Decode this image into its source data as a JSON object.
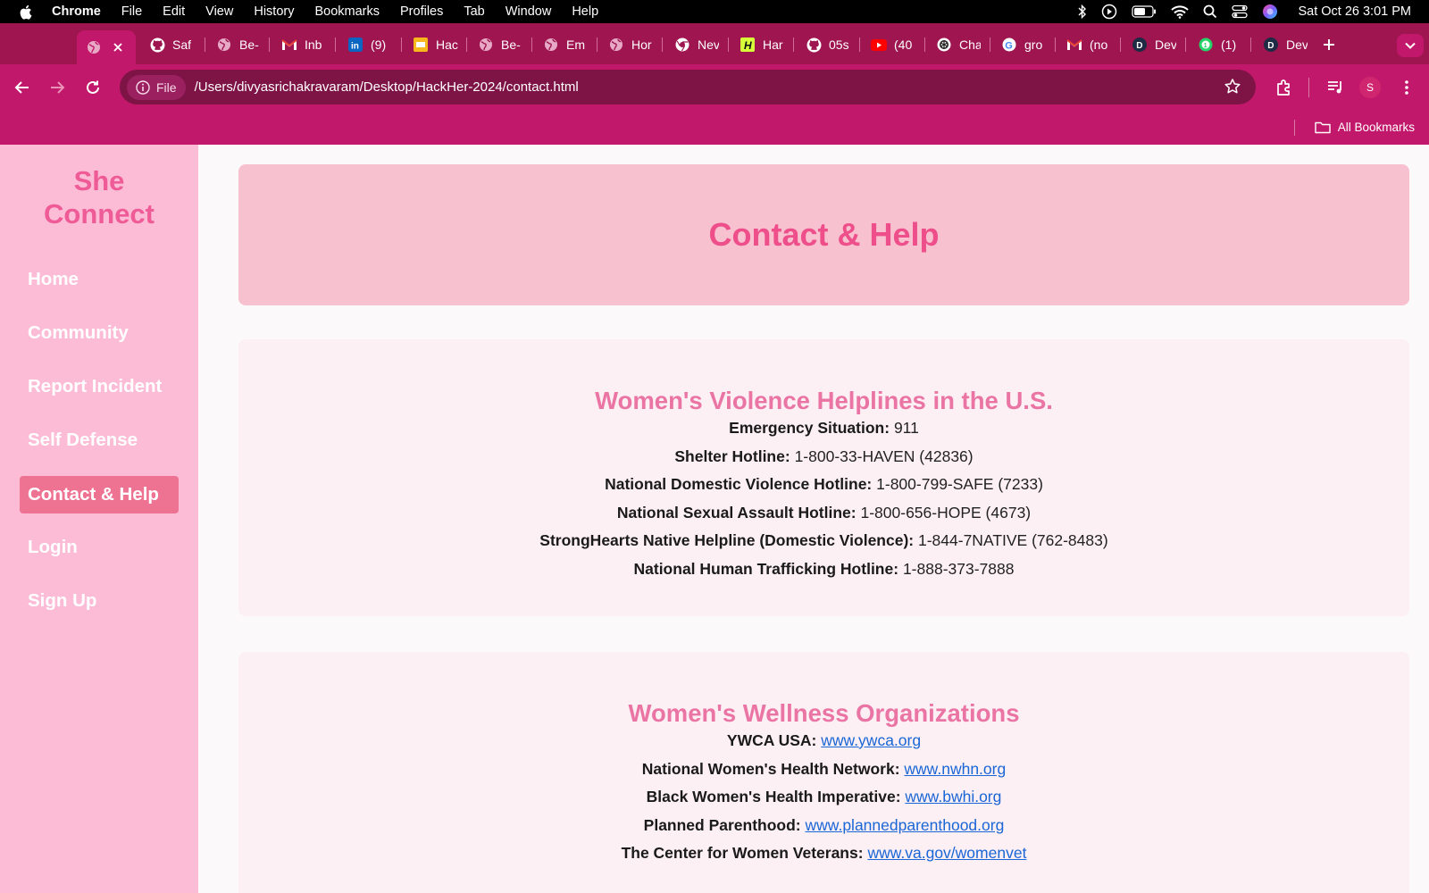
{
  "menubar": {
    "app": "Chrome",
    "items": [
      "File",
      "Edit",
      "View",
      "History",
      "Bookmarks",
      "Profiles",
      "Tab",
      "Window",
      "Help"
    ],
    "clock": "Sat Oct 26  3:01 PM"
  },
  "tabs": [
    {
      "title": "",
      "icon": "globe-icon",
      "active": true
    },
    {
      "title": "Saf",
      "icon": "github-icon"
    },
    {
      "title": "Be-",
      "icon": "globe-icon"
    },
    {
      "title": "Inb",
      "icon": "gmail-icon"
    },
    {
      "title": "(9)",
      "icon": "linkedin-icon"
    },
    {
      "title": "Hac",
      "icon": "slides-icon"
    },
    {
      "title": "Be-",
      "icon": "globe-icon"
    },
    {
      "title": "Em",
      "icon": "globe-icon"
    },
    {
      "title": "Hor",
      "icon": "globe-icon"
    },
    {
      "title": "Nev",
      "icon": "chrome-icon"
    },
    {
      "title": "Har",
      "icon": "h-icon"
    },
    {
      "title": "05s",
      "icon": "github-icon"
    },
    {
      "title": "(40",
      "icon": "youtube-icon"
    },
    {
      "title": "Cha",
      "icon": "openai-icon"
    },
    {
      "title": "gro",
      "icon": "google-icon"
    },
    {
      "title": "(no",
      "icon": "gmail-icon"
    },
    {
      "title": "Dev",
      "icon": "d-icon"
    },
    {
      "title": "(1)",
      "icon": "whatsapp-icon"
    },
    {
      "title": "Dev",
      "icon": "d-icon"
    }
  ],
  "toolbar": {
    "chip_label": "File",
    "url": "/Users/divyasrichakravaram/Desktop/HackHer-2024/contact.html",
    "avatar_letter": "S"
  },
  "bookmarks": {
    "all_label": "All Bookmarks"
  },
  "sidebar": {
    "brand_line1": "She",
    "brand_line2": "Connect",
    "items": [
      {
        "label": "Home"
      },
      {
        "label": "Community"
      },
      {
        "label": "Report Incident"
      },
      {
        "label": "Self Defense"
      },
      {
        "label": "Contact & Help",
        "active": true
      },
      {
        "label": "Login"
      },
      {
        "label": "Sign Up"
      }
    ]
  },
  "hero": {
    "title": "Contact & Help"
  },
  "helplines": {
    "title": "Women's Violence Helplines in the U.S.",
    "items": [
      {
        "label": "Emergency Situation:",
        "value": "911"
      },
      {
        "label": "Shelter Hotline:",
        "value": "1-800-33-HAVEN (42836)"
      },
      {
        "label": "National Domestic Violence Hotline:",
        "value": "1-800-799-SAFE (7233)"
      },
      {
        "label": "National Sexual Assault Hotline:",
        "value": "1-800-656-HOPE (4673)"
      },
      {
        "label": "StrongHearts Native Helpline (Domestic Violence):",
        "value": "1-844-7NATIVE (762-8483)"
      },
      {
        "label": "National Human Trafficking Hotline:",
        "value": "1-888-373-7888"
      }
    ]
  },
  "wellness": {
    "title": "Women's Wellness Organizations",
    "items": [
      {
        "label": "YWCA USA:",
        "link": "www.ywca.org"
      },
      {
        "label": "National Women's Health Network:",
        "link": "www.nwhn.org"
      },
      {
        "label": "Black Women's Health Imperative:",
        "link": "www.bwhi.org"
      },
      {
        "label": "Planned Parenthood:",
        "link": "www.plannedparenthood.org"
      },
      {
        "label": "The Center for Women Veterans:",
        "link": "www.va.gov/womenvet"
      }
    ]
  },
  "colors": {
    "tab_strip": "#9e1550",
    "toolbar": "#c2186b",
    "sidebar": "#fcbcd6",
    "brand": "#ee5b96",
    "active_nav": "#ee7392",
    "hero": "#f8c1cf",
    "card": "#fdf0f4",
    "heading": "#ea74a3",
    "link": "#1a66d6"
  }
}
